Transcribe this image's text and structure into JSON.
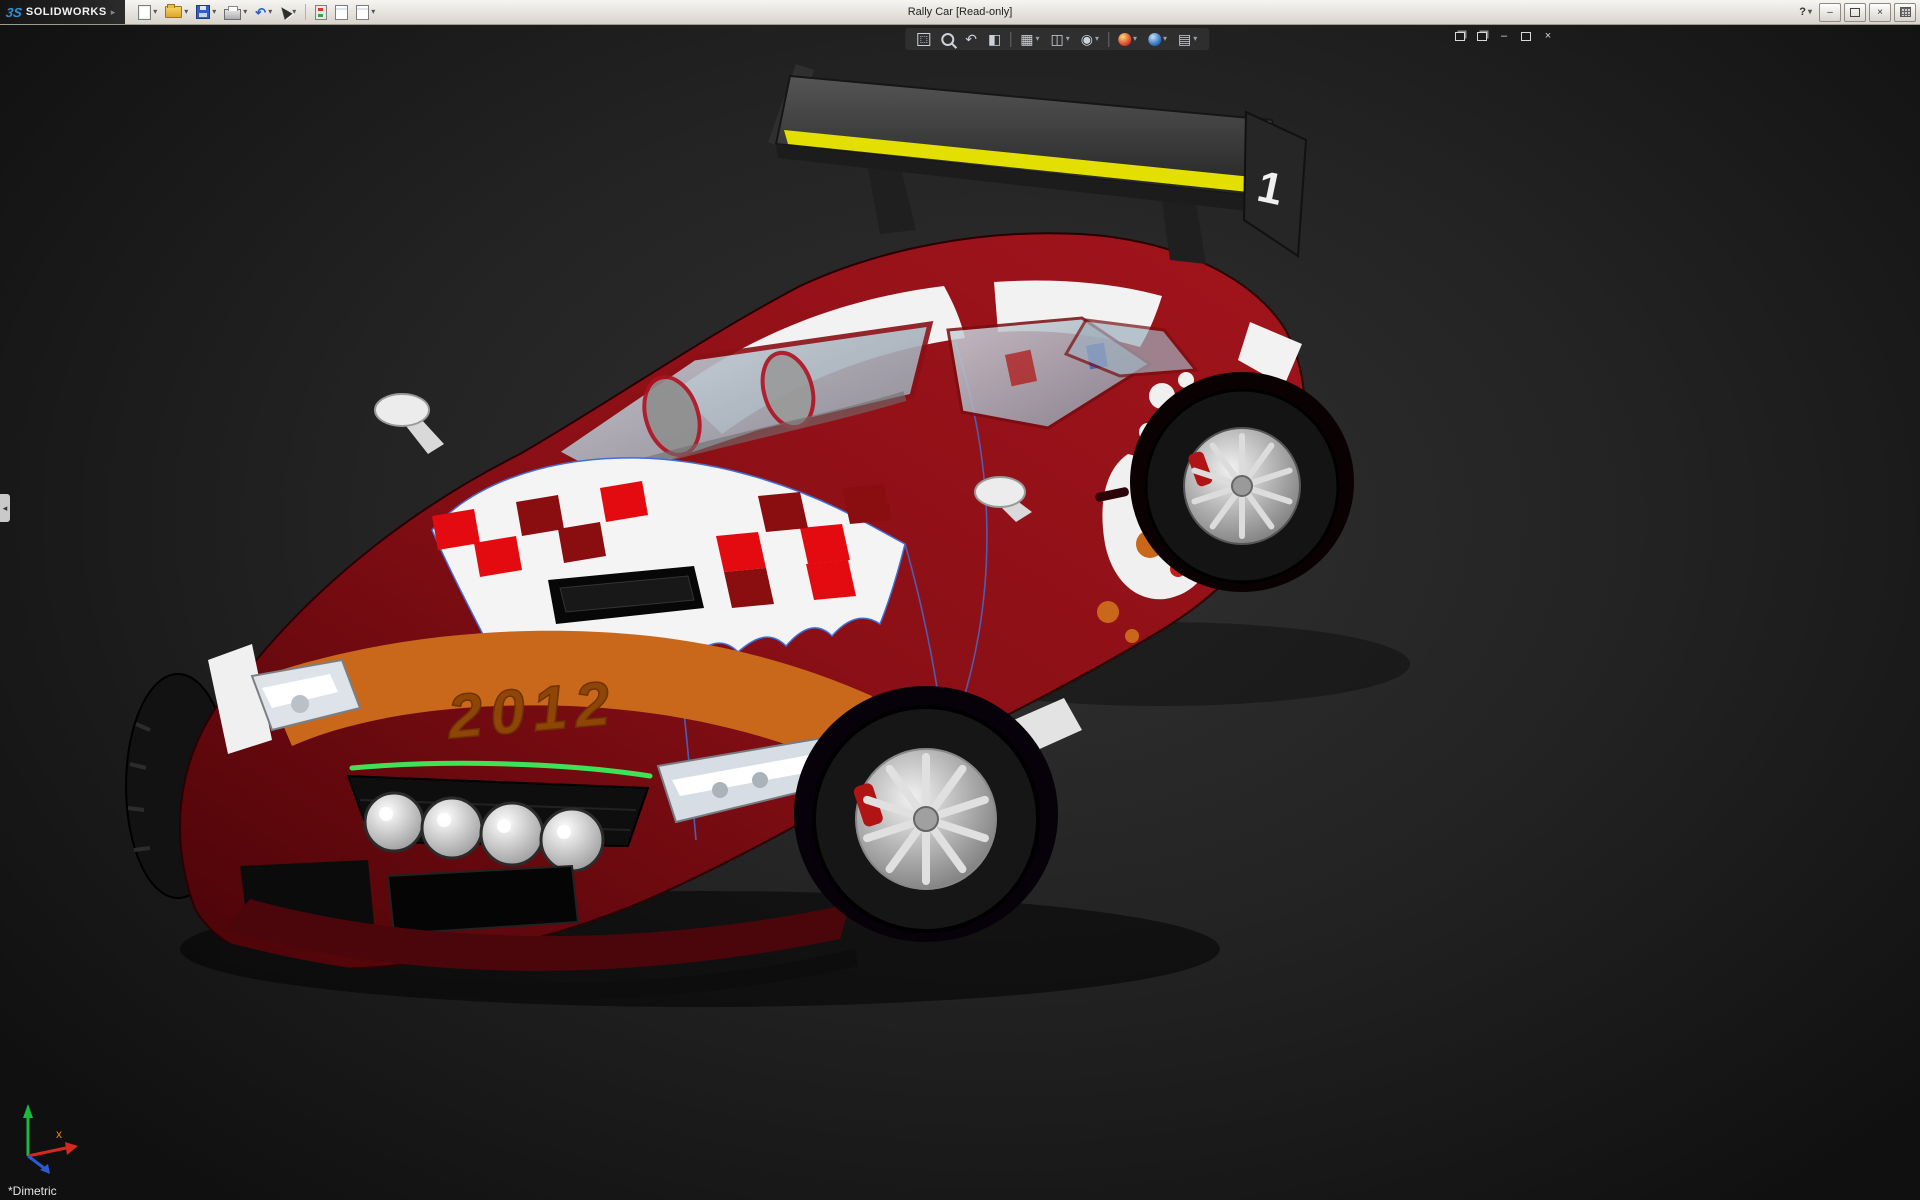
{
  "window": {
    "title": "Rally Car [Read-only]",
    "brand": {
      "mark": "3S",
      "name": "SOLIDWORKS"
    }
  },
  "icons": {
    "glyphs": {
      "caret_down": "▾",
      "caret_right": "▸",
      "help": "?",
      "minimize": "–",
      "close": "×",
      "undo": "↶",
      "previous_view": "↶",
      "section_view": "◧",
      "view_orientation": "▦",
      "display_style": "◫",
      "hide_show": "◉",
      "view_settings": "▤",
      "collapse_left": "◂"
    }
  },
  "main_toolbar": {
    "buttons": [
      "new-document",
      "open",
      "save",
      "print",
      "undo",
      "select",
      "rebuild",
      "file-properties",
      "options"
    ]
  },
  "hud_toolbar": {
    "buttons": [
      "zoom-to-fit",
      "zoom-to-area",
      "previous-view",
      "section-view",
      "view-orientation",
      "display-style",
      "hide-show-items",
      "edit-appearance",
      "apply-scene",
      "view-settings"
    ]
  },
  "viewport": {
    "orientation_label": "*Dimetric",
    "triad": {
      "x_label": "x"
    }
  },
  "model": {
    "name": "Rally Car",
    "decals": {
      "hood_year": "2012",
      "wing_number": "1"
    },
    "colors": {
      "body": "#8a0f16",
      "body_dark": "#4a0408",
      "stripe": "#f2f2f2",
      "wing": "#333333",
      "wing_stripe": "#e3df00",
      "band": "#c9681b",
      "band_text": "#8f4505",
      "grille_accent": "#3fe257",
      "checker_red": "#e30b10",
      "checker_dark": "#8a0d10",
      "glass": "#aeb9c6"
    }
  }
}
